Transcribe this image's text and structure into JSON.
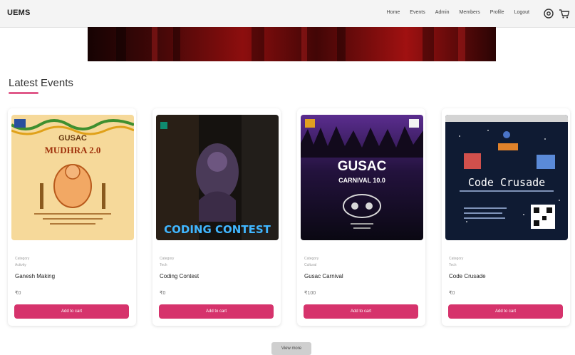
{
  "app": {
    "logo": "UEMS"
  },
  "nav": {
    "items": [
      "Home",
      "Events",
      "Admin",
      "Members",
      "Profile",
      "Logout"
    ]
  },
  "icons": {
    "settings": "gear-icon",
    "cart": "cart-icon"
  },
  "section": {
    "title": "Latest Events"
  },
  "colors": {
    "accent": "#d6336c",
    "underline": "#e05a8a",
    "banner_red": "#8d0e0e"
  },
  "events": [
    {
      "name": "Ganesh Making",
      "meta1": "Category",
      "meta2": "Activity",
      "price": "₹0",
      "button": "Add to cart",
      "poster": {
        "org": "GUSAC",
        "title": "MUDHRA 2.0"
      }
    },
    {
      "name": "Coding Contest",
      "meta1": "Category",
      "meta2": "Tech",
      "price": "₹0",
      "button": "Add to cart",
      "poster": {
        "title": "CODING CONTEST"
      }
    },
    {
      "name": "Gusac Carnival",
      "meta1": "Category",
      "meta2": "Cultural",
      "price": "₹100",
      "button": "Add to cart",
      "poster": {
        "title": "GUSAC",
        "subtitle": "CARNIVAL 10.0"
      }
    },
    {
      "name": "Code Crusade",
      "meta1": "Category",
      "meta2": "Tech",
      "price": "₹0",
      "button": "Add to cart",
      "poster": {
        "title": "Code Crusade"
      }
    }
  ],
  "footer": {
    "view_more": "View more"
  }
}
